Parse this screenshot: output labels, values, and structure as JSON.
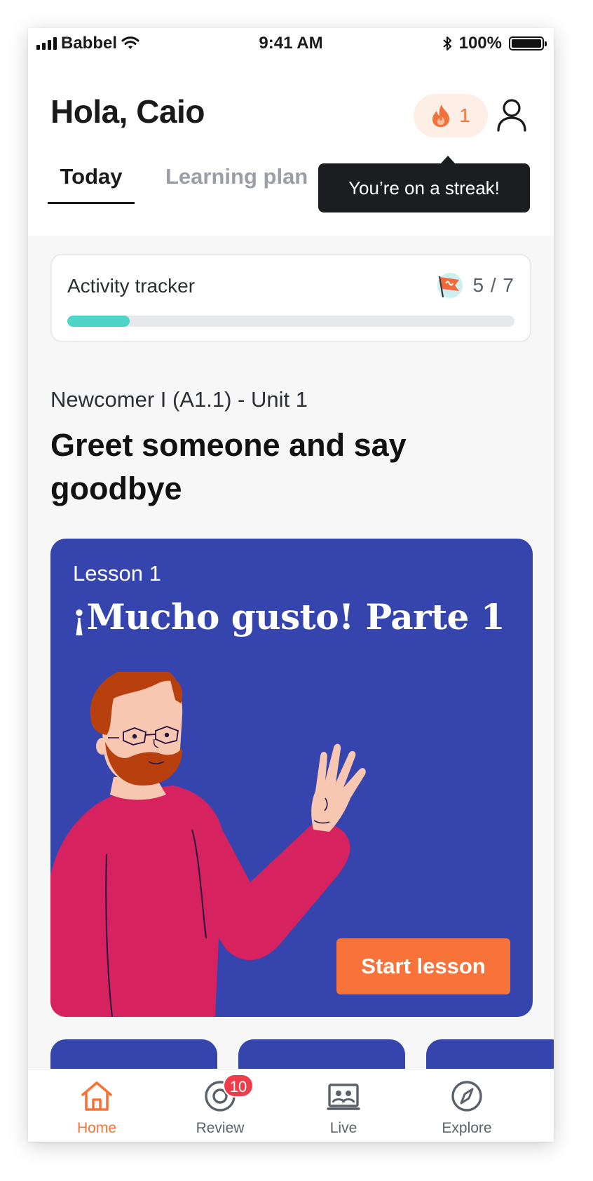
{
  "status_bar": {
    "carrier": "Babbel",
    "time": "9:41 AM",
    "battery": "100%"
  },
  "header": {
    "greeting": "Hola, Caio",
    "streak_count": "1",
    "tabs": [
      {
        "label": "Today",
        "active": true
      },
      {
        "label": "Learning plan",
        "active": false
      }
    ],
    "tooltip": "You’re on a streak!"
  },
  "tracker": {
    "title": "Activity tracker",
    "count": "5 / 7",
    "progress_fraction": 0.14
  },
  "unit": {
    "label": "Newcomer I (A1.1) - Unit 1",
    "title": "Greet someone and say goodbye"
  },
  "lesson": {
    "number": "Lesson 1",
    "title": "¡Mucho gusto! Parte 1",
    "button": "Start lesson"
  },
  "bottom_nav": [
    {
      "label": "Home",
      "icon": "home-icon",
      "active": true
    },
    {
      "label": "Review",
      "icon": "review-icon",
      "badge": "10"
    },
    {
      "label": "Live",
      "icon": "live-icon"
    },
    {
      "label": "Explore",
      "icon": "compass-icon"
    }
  ],
  "colors": {
    "accent": "#f7733a",
    "card": "#3645ad",
    "progress": "#4fd4c8",
    "badge": "#ef3b4a"
  }
}
